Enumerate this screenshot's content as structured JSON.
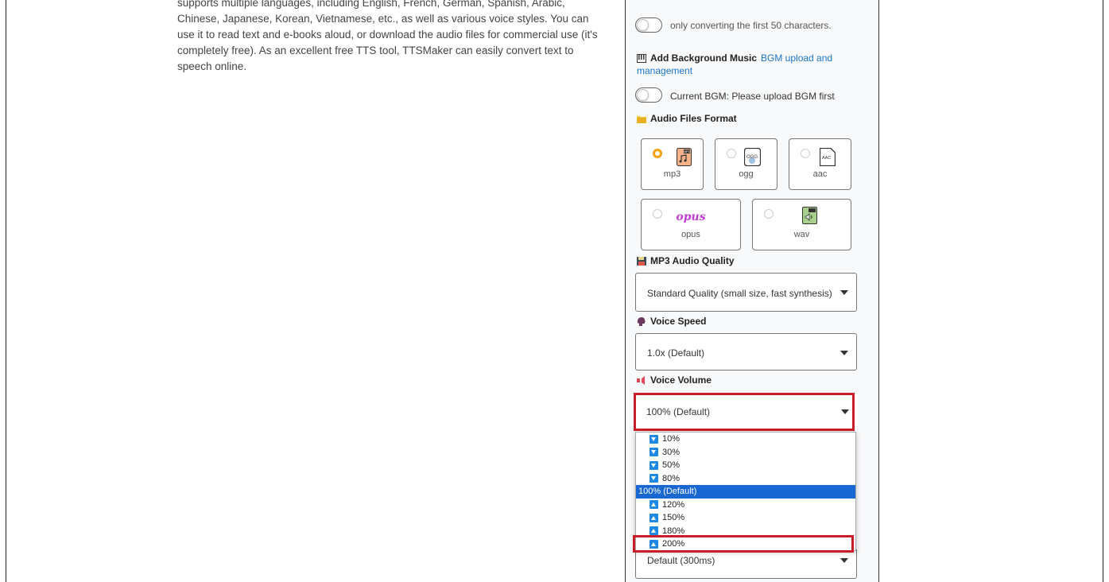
{
  "intro_text": {
    "partial_top": "supports multiple languages, including English, French, German, Spanish, Arabic,",
    "line1": "Chinese, Japanese, Korean, Vietnamese, etc., as well as various voice styles. You can",
    "line2": "use it to read text and e-books aloud, or download the audio files for commercial use (it's",
    "line3": "completely free). As an excellent free TTS tool, TTSMaker can easily convert text to",
    "line4": "speech online."
  },
  "preview_toggle": {
    "label": "only converting the first 50 characters."
  },
  "bgm": {
    "title": "Add Background Music",
    "link_line1": "BGM upload and",
    "link_line2": "management",
    "toggle_label": "Current BGM: Please upload BGM first"
  },
  "audio_format": {
    "title": "Audio Files Format",
    "options": [
      {
        "label": "mp3",
        "selected": true,
        "icon": "mp3-file-icon"
      },
      {
        "label": "ogg",
        "selected": false,
        "icon": "ogg-file-icon"
      },
      {
        "label": "aac",
        "selected": false,
        "icon": "aac-file-icon"
      },
      {
        "label": "opus",
        "selected": false,
        "icon": "opus-logo-icon",
        "logo_text": "opus"
      },
      {
        "label": "wav",
        "selected": false,
        "icon": "wav-file-icon"
      }
    ]
  },
  "mp3_quality": {
    "title": "MP3 Audio Quality",
    "value": "Standard Quality (small size, fast synthesis)"
  },
  "voice_speed": {
    "title": "Voice Speed",
    "value": "1.0x (Default)"
  },
  "voice_volume": {
    "title": "Voice Volume",
    "value": "100% (Default)",
    "options": [
      {
        "label": "10%",
        "dir": "down"
      },
      {
        "label": "30%",
        "dir": "down"
      },
      {
        "label": "50%",
        "dir": "down"
      },
      {
        "label": "80%",
        "dir": "down"
      },
      {
        "label": "100% (Default)",
        "dir": "none",
        "selected": true
      },
      {
        "label": "120%",
        "dir": "up"
      },
      {
        "label": "150%",
        "dir": "up"
      },
      {
        "label": "180%",
        "dir": "up"
      },
      {
        "label": "200%",
        "dir": "up",
        "highlighted": true
      }
    ]
  },
  "pause_select": {
    "value": "Default (300ms)"
  },
  "colors": {
    "highlight_red": "#c81e28",
    "selected_blue": "#1967d2",
    "link_blue": "#1a73c8",
    "radio_orange": "#f0a30a"
  }
}
